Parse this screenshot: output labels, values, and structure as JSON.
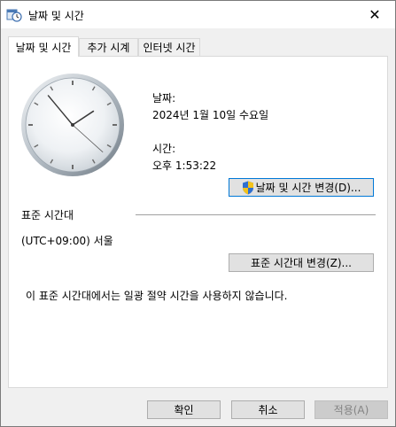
{
  "window": {
    "title": "날짜 및 시간",
    "close_glyph": "✕"
  },
  "tabs": [
    {
      "label": "날짜 및 시간",
      "active": true
    },
    {
      "label": "추가 시계",
      "active": false
    },
    {
      "label": "인터넷 시간",
      "active": false
    }
  ],
  "clock": {
    "hour": 1,
    "minute": 53,
    "second": 22
  },
  "date": {
    "label": "날짜:",
    "value": "2024년 1월 10일 수요일"
  },
  "time": {
    "label": "시간:",
    "value": "오후 1:53:22"
  },
  "change_datetime_button": "날짜 및 시간 변경(D)...",
  "timezone": {
    "section_label": "표준 시간대",
    "value": "(UTC+09:00) 서울",
    "change_button": "표준 시간대 변경(Z)..."
  },
  "dst_note": "이 표준 시간대에서는 일광 절약 시간을 사용하지 않습니다.",
  "footer": {
    "ok": "확인",
    "cancel": "취소",
    "apply": "적용(A)"
  },
  "colors": {
    "focus_border": "#0078d7",
    "panel_bg": "#ffffff",
    "dialog_bg": "#f0f0f0"
  }
}
